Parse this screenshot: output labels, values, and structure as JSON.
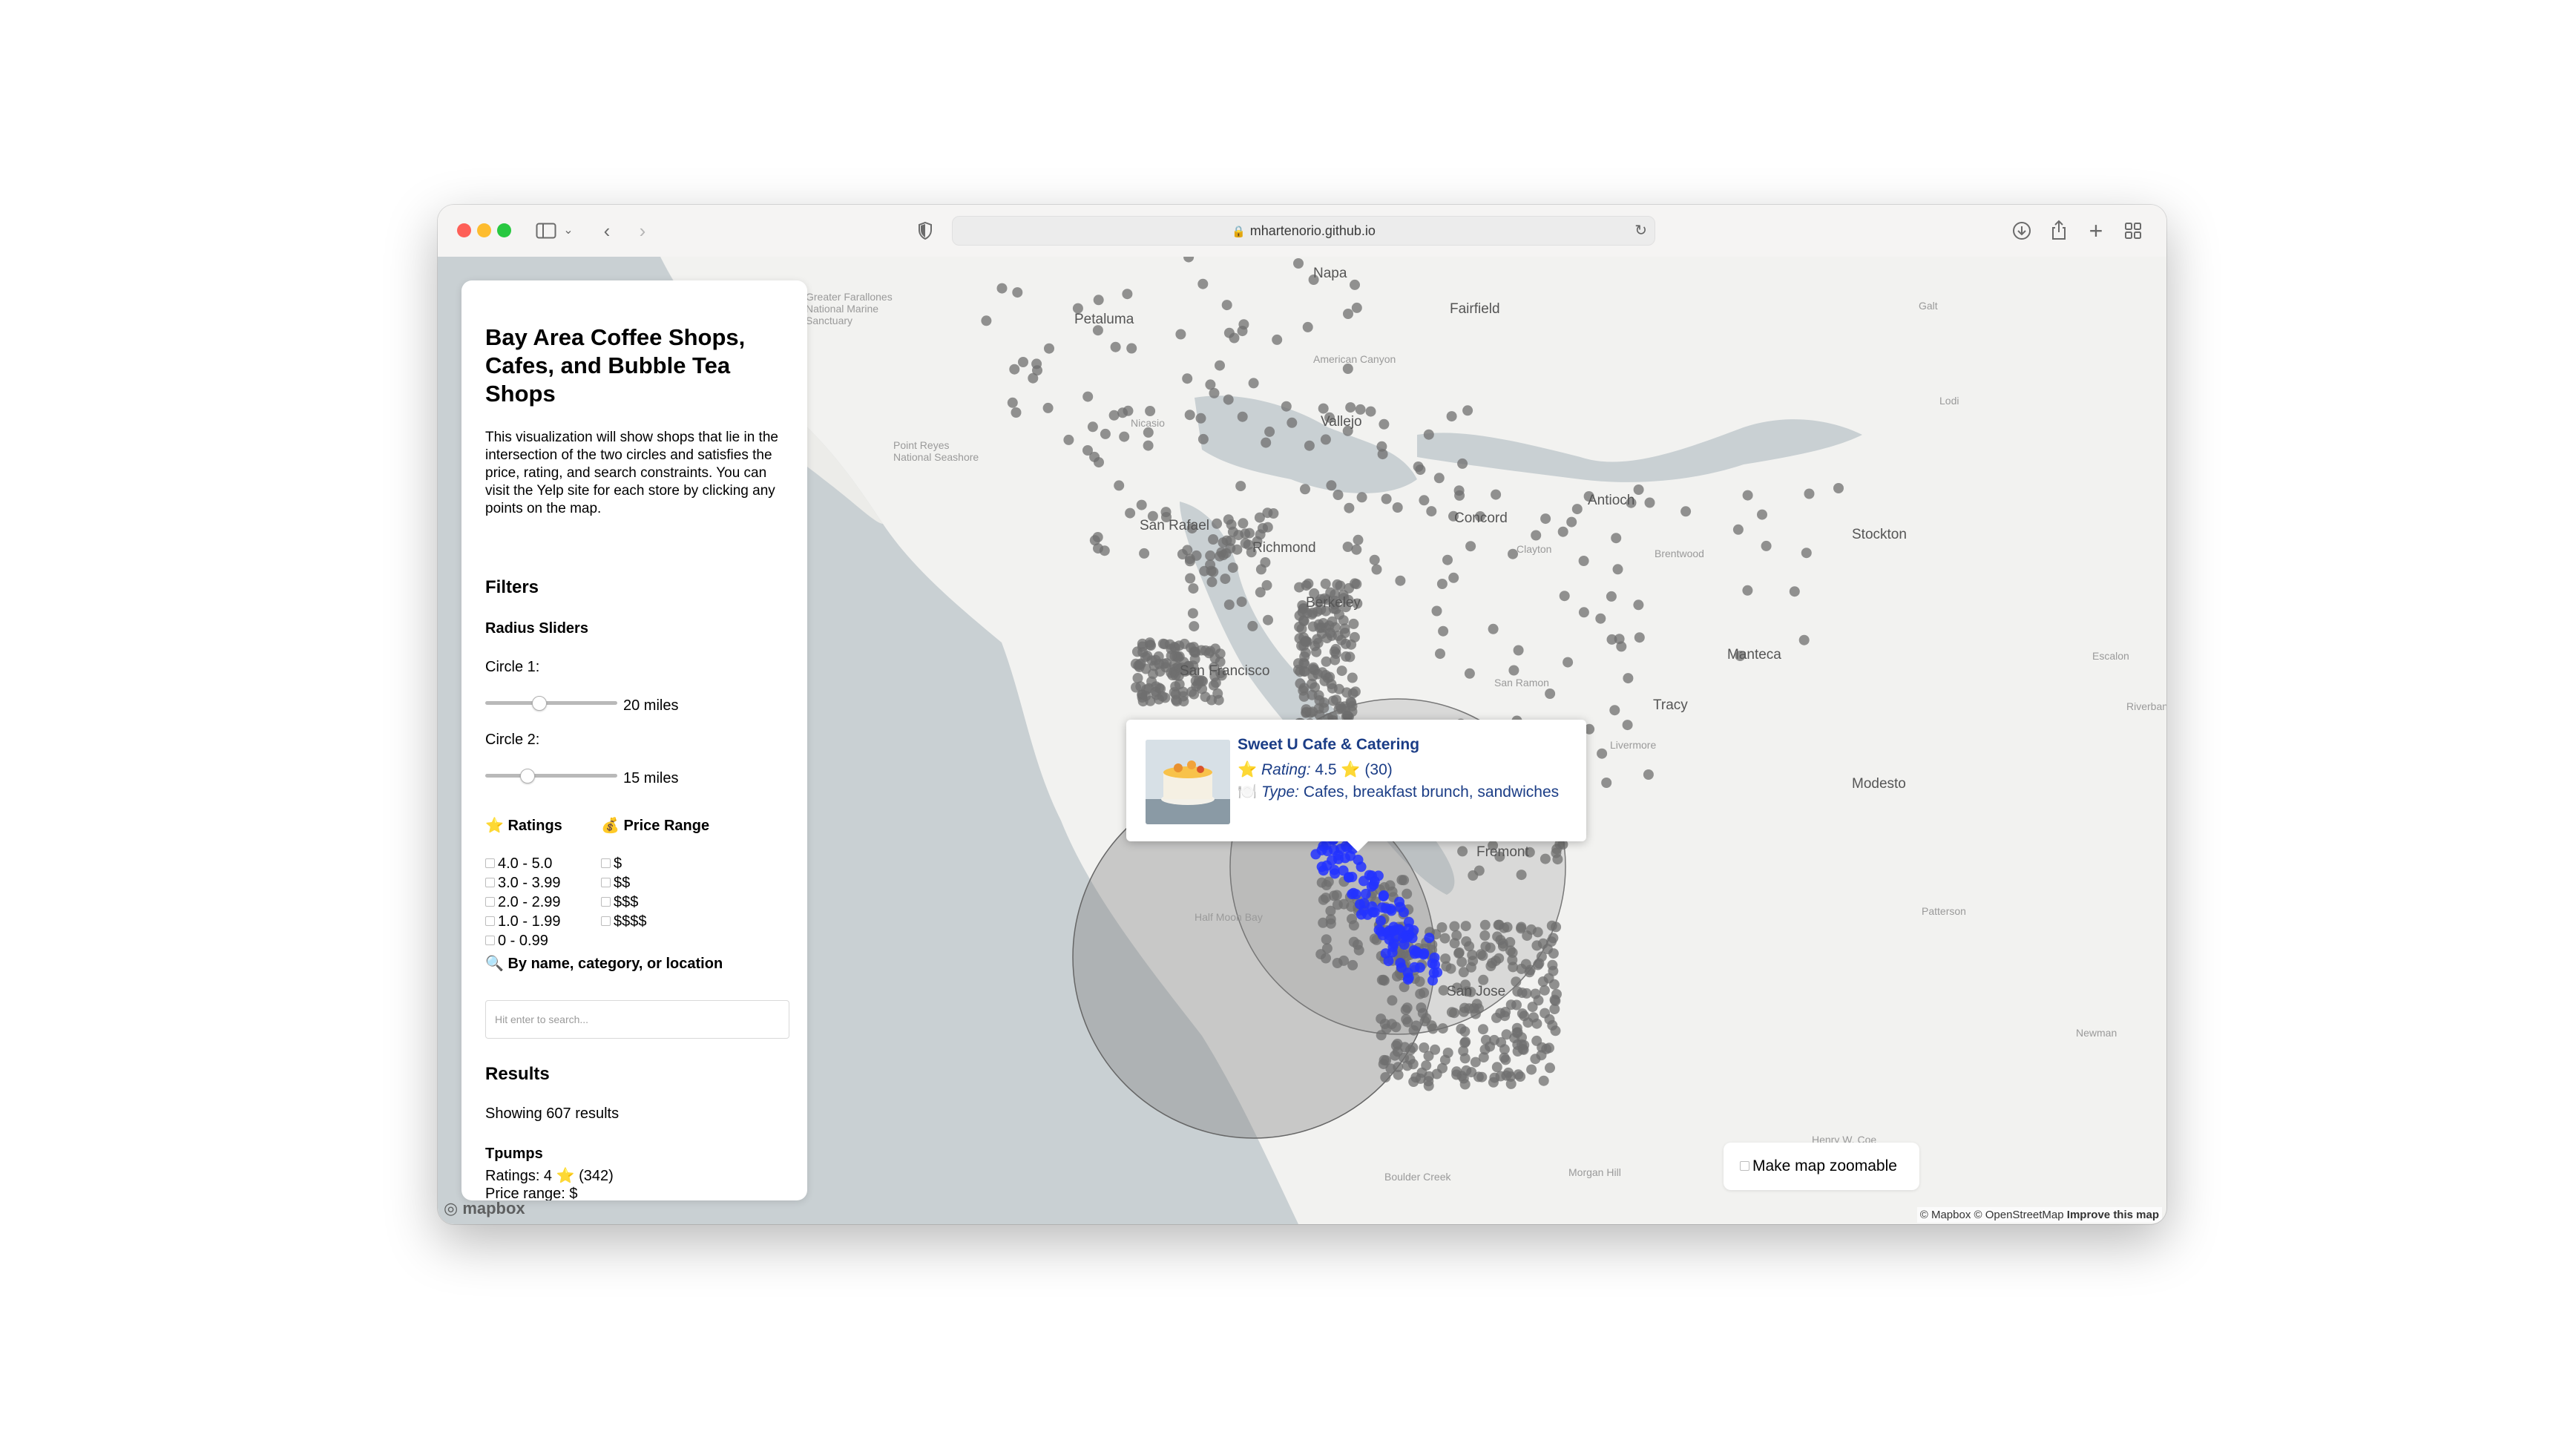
{
  "browser": {
    "url": "mhartenorio.github.io"
  },
  "sidebar": {
    "title": "Bay Area Coffee Shops, Cafes, and Bubble Tea Shops",
    "description": "This visualization will show shops that lie in the intersection of the two circles and satisfies the price, rating, and search constraints. You can visit the Yelp site for each store by clicking any points on the map.",
    "filters_heading": "Filters",
    "radius_heading": "Radius Sliders",
    "circle1_label": "Circle 1:",
    "circle1_value": "20 miles",
    "circle1_fraction": 0.4,
    "circle2_label": "Circle 2:",
    "circle2_value": "15 miles",
    "circle2_fraction": 0.3,
    "ratings_heading": "⭐ Ratings",
    "price_heading": "💰 Price Range",
    "ratings_options": [
      "4.0 - 5.0",
      "3.0 - 3.99",
      "2.0 - 2.99",
      "1.0 - 1.99",
      "0 - 0.99"
    ],
    "price_options": [
      "$",
      "$$",
      "$$$",
      "$$$$"
    ],
    "search_heading": "🔍 By name, category, or location",
    "search_placeholder": "Hit enter to search...",
    "results_heading": "Results",
    "results_count": "Showing 607 results",
    "first_result": {
      "name": "Tpumps",
      "ratings": "Ratings: 4 ⭐ (342)",
      "price": "Price range: $"
    }
  },
  "popup": {
    "name": "Sweet U Cafe & Catering",
    "rating_icon": "⭐",
    "rating_label": "Rating:",
    "rating_value": "4.5 ⭐ (30)",
    "type_icon": "🍽️",
    "type_label": "Type:",
    "type_value": "Cafes, breakfast brunch, sandwiches"
  },
  "map": {
    "zoom_toggle_label": "Make map zoomable",
    "attribution_prefix": "© Mapbox © OpenStreetMap",
    "attribution_link": "Improve this map",
    "logo": "mapbox",
    "places": [
      {
        "name": "Petaluma",
        "cls": "city"
      },
      {
        "name": "Napa",
        "cls": "city"
      },
      {
        "name": "Fairfield",
        "cls": "city"
      },
      {
        "name": "Vallejo",
        "cls": "city"
      },
      {
        "name": "Antioch",
        "cls": "city"
      },
      {
        "name": "Stockton",
        "cls": "city"
      },
      {
        "name": "Richmond",
        "cls": "city"
      },
      {
        "name": "Concord",
        "cls": "city"
      },
      {
        "name": "San Rafael",
        "cls": "city"
      },
      {
        "name": "Manteca",
        "cls": "city"
      },
      {
        "name": "Tracy",
        "cls": "city"
      },
      {
        "name": "Modesto",
        "cls": "city"
      },
      {
        "name": "Berkeley",
        "cls": "city"
      },
      {
        "name": "San Francisco",
        "cls": "city"
      },
      {
        "name": "Galt",
        "cls": "small"
      },
      {
        "name": "Lodi",
        "cls": "small"
      },
      {
        "name": "Brentwood",
        "cls": "small"
      },
      {
        "name": "Escalon",
        "cls": "small"
      },
      {
        "name": "Riverbank",
        "cls": "small"
      },
      {
        "name": "Patterson",
        "cls": "small"
      },
      {
        "name": "Newman",
        "cls": "small"
      },
      {
        "name": "Livermore",
        "cls": "small"
      },
      {
        "name": "San Ramon",
        "cls": "small"
      },
      {
        "name": "Clayton",
        "cls": "small"
      },
      {
        "name": "Nicasio",
        "cls": "small"
      },
      {
        "name": "American Canyon",
        "cls": "small"
      },
      {
        "name": "Point Reyes National Seashore",
        "cls": "small"
      },
      {
        "name": "Greater Farallones National Marine Sanctuary",
        "cls": "small"
      },
      {
        "name": "Half Moon Bay",
        "cls": "small"
      },
      {
        "name": "Boulder Creek",
        "cls": "small"
      },
      {
        "name": "Morgan Hill",
        "cls": "small"
      },
      {
        "name": "Henry W. Coe State Park",
        "cls": "small"
      },
      {
        "name": "Fremont",
        "cls": "city"
      },
      {
        "name": "San Jose",
        "cls": "city"
      }
    ]
  }
}
